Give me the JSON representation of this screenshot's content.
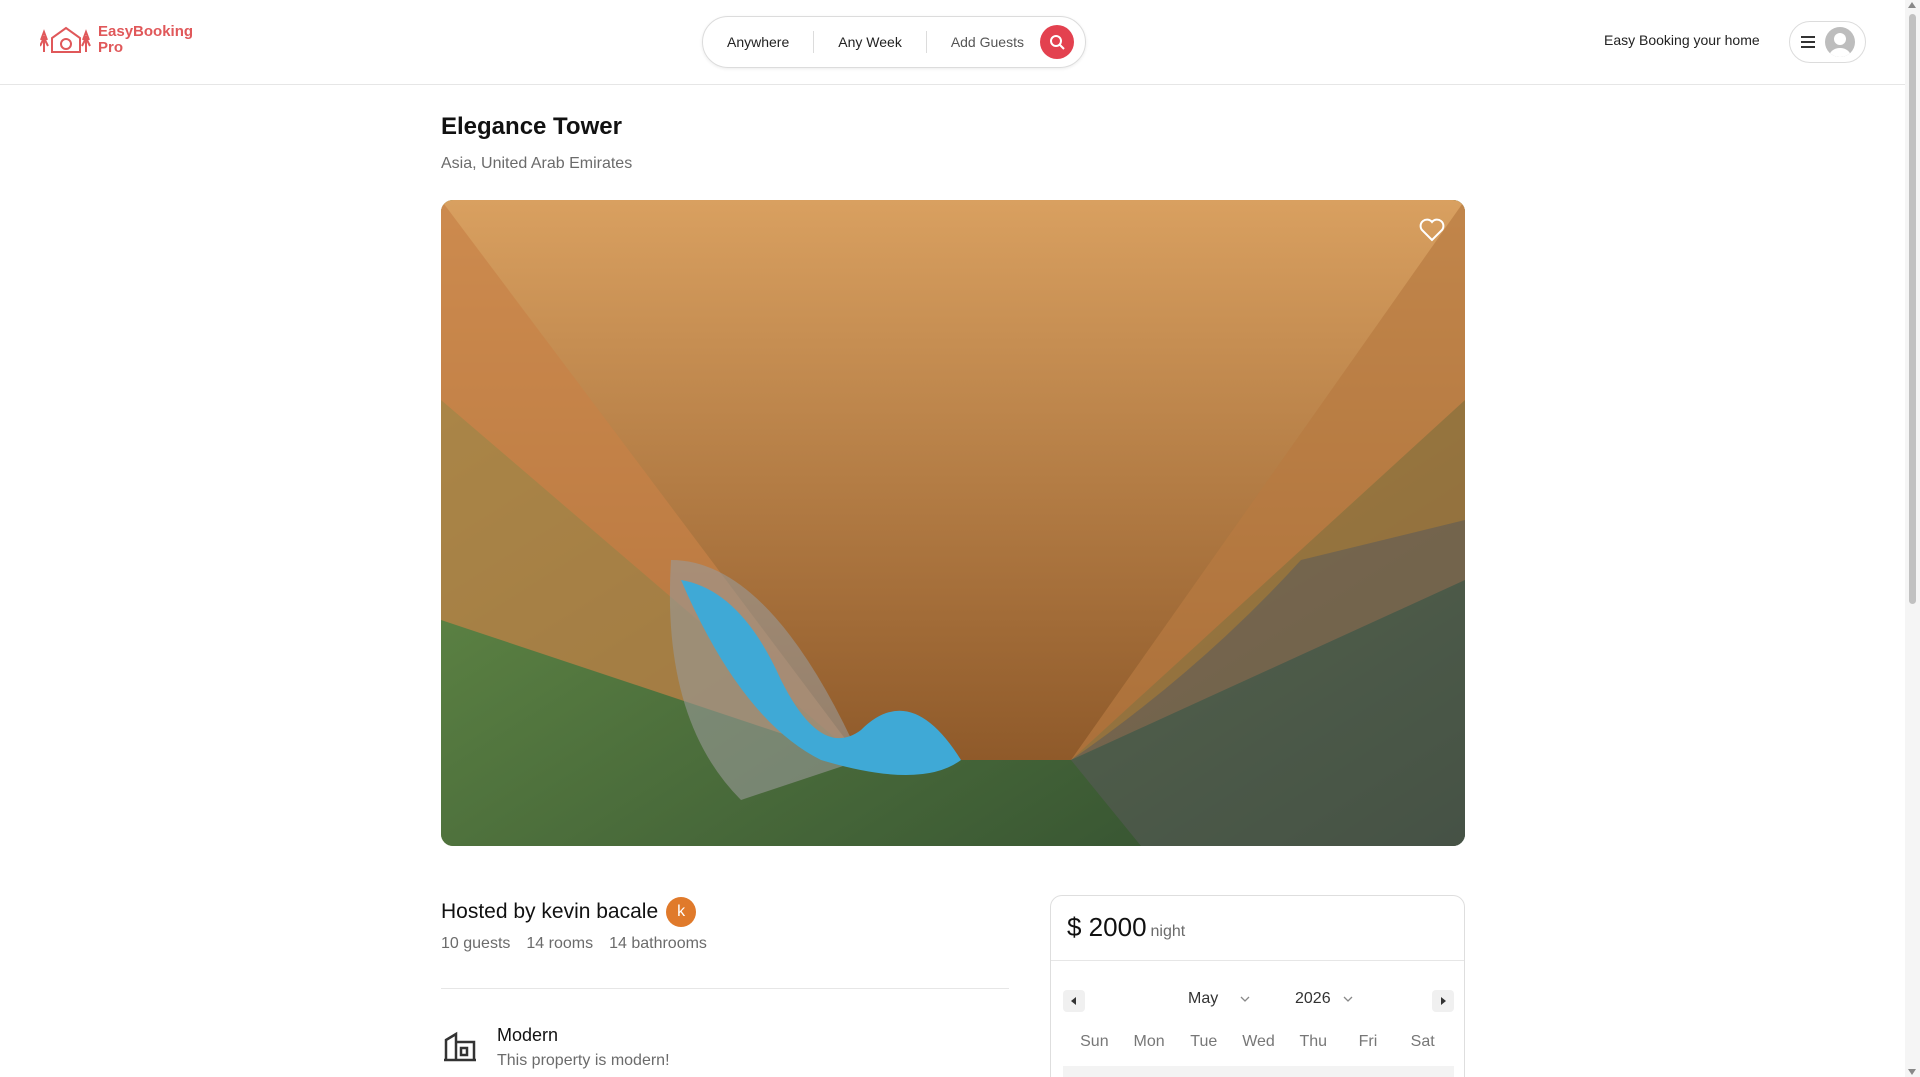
{
  "header": {
    "logo_line1": "EasyBooking",
    "logo_line2": "Pro",
    "search": {
      "location": "Anywhere",
      "week": "Any Week",
      "guests": "Add Guests"
    },
    "right_text": "Easy Booking your home"
  },
  "listing": {
    "title": "Elegance Tower",
    "location": "Asia, United Arab Emirates",
    "host_text": "Hosted by kevin bacale",
    "host_initial": "k",
    "stats": {
      "guests": "10 guests",
      "rooms": "14 rooms",
      "bathrooms": "14 bathrooms"
    },
    "feature": {
      "title": "Modern",
      "description": "This property is modern!"
    }
  },
  "booking": {
    "price": "$ 2000",
    "price_unit": "night",
    "month": "May",
    "year": "2026",
    "weekdays": [
      "Sun",
      "Mon",
      "Tue",
      "Wed",
      "Thu",
      "Fri",
      "Sat"
    ]
  },
  "colors": {
    "brand": "#e0585a",
    "search_button": "#e3414f",
    "host_avatar": "#e07a2b"
  },
  "icons": {
    "logo": "house-trees-logo-icon",
    "search": "search-icon",
    "menu": "hamburger-menu-icon",
    "avatar": "user-avatar-icon",
    "favorite": "heart-icon",
    "feature": "building-icon",
    "prev": "chevron-left-icon",
    "next": "chevron-right-icon",
    "dropdown": "chevron-down-icon"
  }
}
